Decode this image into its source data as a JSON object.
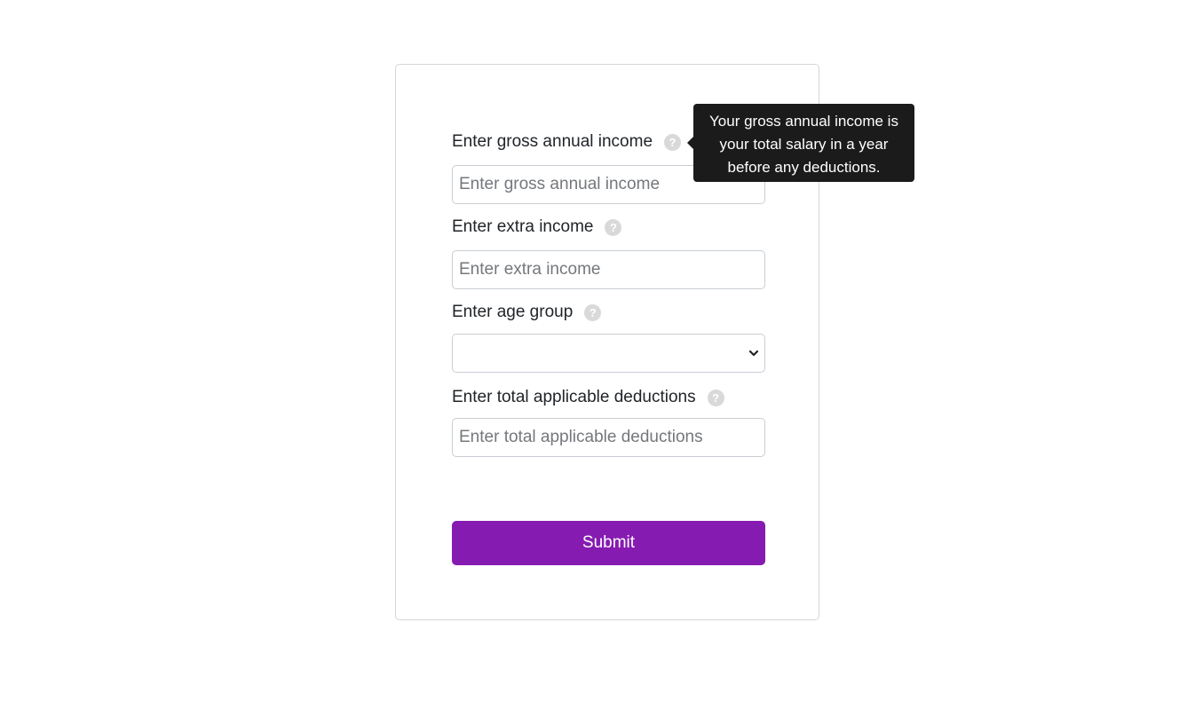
{
  "form": {
    "gross_income": {
      "label": "Enter gross annual income",
      "placeholder": "Enter gross annual income",
      "value": ""
    },
    "extra_income": {
      "label": "Enter extra income",
      "placeholder": "Enter extra income",
      "value": ""
    },
    "age_group": {
      "label": "Enter age group",
      "selected": ""
    },
    "deductions": {
      "label": "Enter total applicable deductions",
      "placeholder": "Enter total applicable deductions",
      "value": ""
    },
    "help_glyph": "?",
    "submit_label": "Submit"
  },
  "tooltip": {
    "text": "Your gross annual income is your total salary in a year before any deductions."
  },
  "colors": {
    "accent": "#861bb1",
    "tooltip_bg": "#1b1b1b",
    "help_icon": "#d9d9d9"
  },
  "icons": [
    "help-icon",
    "chevron-down-icon"
  ]
}
